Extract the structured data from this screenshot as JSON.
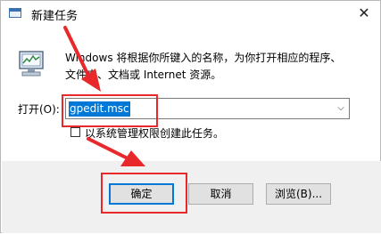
{
  "window": {
    "title": "新建任务",
    "icon": "run-window-icon",
    "close_glyph": "✕"
  },
  "body": {
    "icon": "computer-run-icon",
    "description_line1": "Windows 将根据你所键入的名称，为你打开相应的程序、",
    "description_line2": "文件夹、文档或 Internet 资源。"
  },
  "open_field": {
    "label": "打开(O):",
    "value": "gpedit.msc",
    "dropdown_glyph": "⌵"
  },
  "admin_option": {
    "label": "以系统管理权限创建此任务。",
    "checked": false
  },
  "buttons": {
    "ok": "确定",
    "cancel": "取消",
    "browse": "浏览(B)..."
  },
  "annotations": {
    "highlight_color": "#e8282b"
  }
}
